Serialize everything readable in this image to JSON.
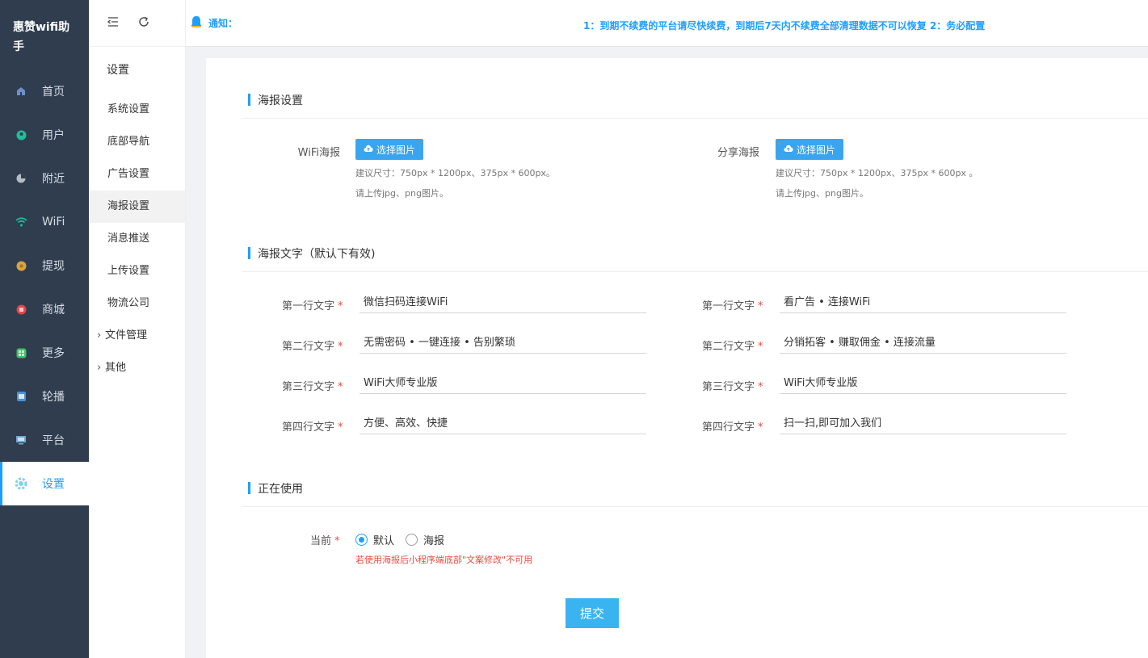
{
  "app": {
    "brand": "惠赞wifi助手"
  },
  "sidebar": {
    "items": [
      {
        "label": "首页",
        "icon": "home-icon",
        "color": "#6f8fc9"
      },
      {
        "label": "用户",
        "icon": "user-icon",
        "color": "#1fbf9a"
      },
      {
        "label": "附近",
        "icon": "pie-icon",
        "color": "#b7bcc4"
      },
      {
        "label": "WiFi",
        "icon": "wifi-icon",
        "color": "#1fbf9a"
      },
      {
        "label": "提现",
        "icon": "coin-icon",
        "color": "#d9a441"
      },
      {
        "label": "商城",
        "icon": "shop-icon",
        "color": "#e0474c"
      },
      {
        "label": "更多",
        "icon": "grid-icon",
        "color": "#43c06b"
      },
      {
        "label": "轮播",
        "icon": "carousel-icon",
        "color": "#4a90d9"
      },
      {
        "label": "平台",
        "icon": "monitor-icon",
        "color": "#6fa8d6"
      },
      {
        "label": "设置",
        "icon": "gear-icon",
        "color": "#7fd3e8",
        "active": true
      }
    ]
  },
  "submenu": {
    "title": "设置",
    "items": [
      {
        "label": "系统设置"
      },
      {
        "label": "底部导航"
      },
      {
        "label": "广告设置"
      },
      {
        "label": "海报设置",
        "active": true
      },
      {
        "label": "消息推送"
      },
      {
        "label": "上传设置"
      },
      {
        "label": "物流公司"
      },
      {
        "label": "文件管理",
        "group": true
      },
      {
        "label": "其他",
        "group": true
      }
    ]
  },
  "header": {
    "notice_label": "通知：",
    "notice_text": "1：到期不续费的平台请尽快续费，到期后7天内不续费全部清理数据不可以恢复 2：务必配置"
  },
  "poster_settings": {
    "title": "海报设置",
    "wifi_label": "WiFi海报",
    "share_label": "分享海报",
    "choose_label": "选择图片",
    "hint_wifi_1": "建议尺寸：750px * 1200px、375px * 600px。",
    "hint_share_1": "建议尺寸：750px * 1200px、375px * 600px 。",
    "hint_2": "请上传jpg、png图片。"
  },
  "poster_text": {
    "title": "海报文字（默认下有效)",
    "labels": [
      "第一行文字",
      "第二行文字",
      "第三行文字",
      "第四行文字"
    ],
    "left": [
      "微信扫码连接WiFi",
      "无需密码 • 一键连接 • 告别繁琐",
      "WiFi大师专业版",
      "方便、高效、快捷"
    ],
    "right": [
      "看广告 • 连接WiFi",
      "分销拓客 • 赚取佣金 • 连接流量",
      "WiFi大师专业版",
      "扫一扫,即可加入我们"
    ],
    "required_mark": "*"
  },
  "in_use": {
    "title": "正在使用",
    "current_label": "当前",
    "options": [
      {
        "label": "默认",
        "checked": true
      },
      {
        "label": "海报",
        "checked": false
      }
    ],
    "warning": "若使用海报后小程序端底部\"文案修改\"不可用"
  },
  "submit_label": "提交"
}
